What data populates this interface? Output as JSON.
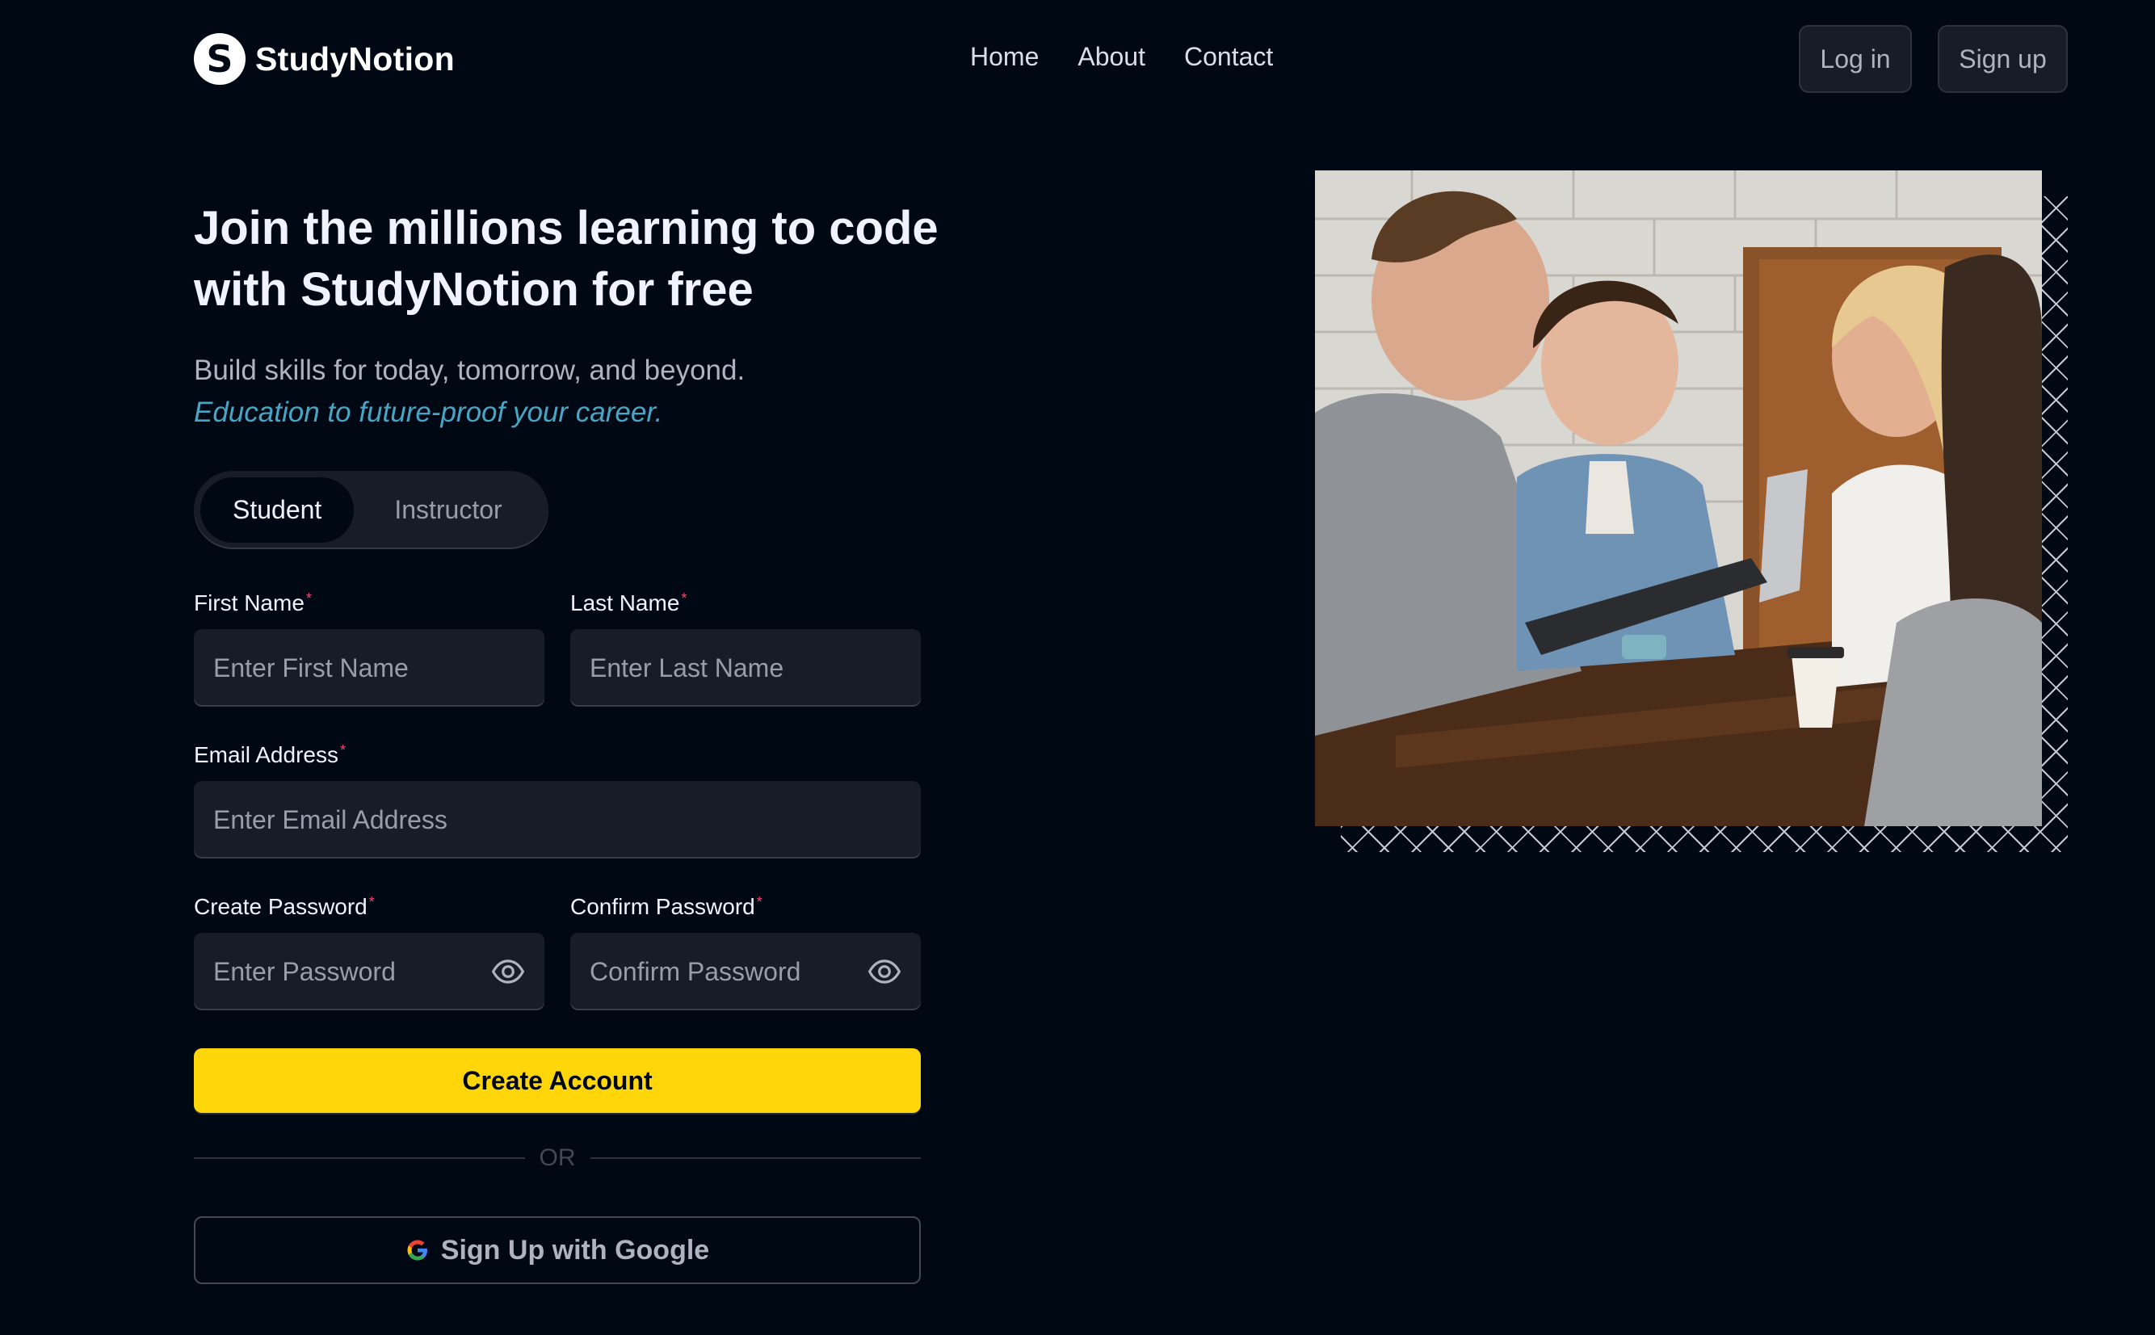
{
  "navbar": {
    "logo_letter": "S",
    "brand": "StudyNotion",
    "links": [
      "Home",
      "About",
      "Contact"
    ],
    "login_label": "Log in",
    "signup_label": "Sign up"
  },
  "hero": {
    "heading": "Join the millions learning to code with StudyNotion for free",
    "subheading": "Build skills for today, tomorrow, and beyond.",
    "subheading_accent": "Education to future-proof your career."
  },
  "role_toggle": {
    "options": [
      "Student",
      "Instructor"
    ],
    "selected": "Student"
  },
  "form": {
    "first_name": {
      "label": "First Name",
      "placeholder": "Enter First Name",
      "value": ""
    },
    "last_name": {
      "label": "Last Name",
      "placeholder": "Enter Last Name",
      "value": ""
    },
    "email": {
      "label": "Email Address",
      "placeholder": "Enter Email Address",
      "value": ""
    },
    "password": {
      "label": "Create Password",
      "placeholder": "Enter Password",
      "value": ""
    },
    "confirm_password": {
      "label": "Confirm Password",
      "placeholder": "Confirm Password",
      "value": ""
    },
    "required_mark": "*",
    "submit_label": "Create Account",
    "divider_text": "OR",
    "google_label": "Sign Up with Google"
  },
  "colors": {
    "background": "#000814",
    "accent_yellow": "#ffd60a",
    "accent_blue": "#47a5c5",
    "required_red": "#ef476f"
  },
  "icons": [
    "eye-icon",
    "google-icon"
  ]
}
